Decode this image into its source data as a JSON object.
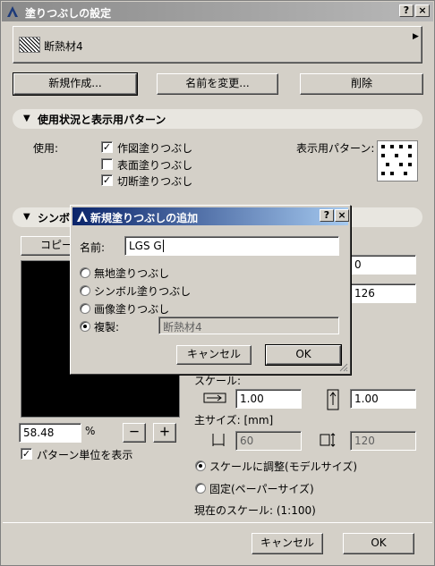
{
  "window": {
    "title": "塗りつぶしの設定",
    "help_btn": "?",
    "close_btn": "×",
    "fill_name": "断熱材4",
    "new_btn": "新規作成...",
    "rename_btn": "名前を変更...",
    "delete_btn": "削除",
    "usage_section": "使用状況と表示用パターン",
    "usage_label": "使用:",
    "usage_options": [
      {
        "label": "作図塗りつぶし",
        "checked": true
      },
      {
        "label": "表面塗りつぶし",
        "checked": false
      },
      {
        "label": "切断塗りつぶし",
        "checked": true
      }
    ],
    "display_pattern_label": "表示用パターン:",
    "symbol_section_partial": "シンボ",
    "copy_btn_partial": "コピー",
    "field_right_1_partial": "0",
    "field_right_2_partial": "126",
    "zoom_value": "58.48",
    "zoom_unit": "%",
    "zoom_out": "－",
    "zoom_in": "＋",
    "show_pattern_units": {
      "label": "パターン単位を表示",
      "checked": true
    },
    "scale_label": "スケール:",
    "scale_x": "1.00",
    "scale_y": "1.00",
    "main_size_label": "主サイズ: [mm]",
    "main_size_x": "60",
    "main_size_y": "120",
    "scale_mode_options": [
      {
        "label": "スケールに調整(モデルサイズ)",
        "selected": true
      },
      {
        "label": "固定(ペーパーサイズ)",
        "selected": false
      }
    ],
    "current_scale": "現在のスケール: (1:100)",
    "cancel_btn": "キャンセル",
    "ok_btn": "OK"
  },
  "dialog": {
    "title": "新規塗りつぶしの追加",
    "help_btn": "?",
    "close_btn": "×",
    "name_label": "名前:",
    "name_value": "LGS G",
    "options": [
      {
        "label": "無地塗りつぶし",
        "selected": false
      },
      {
        "label": "シンボル塗りつぶし",
        "selected": false
      },
      {
        "label": "画像塗りつぶし",
        "selected": false
      },
      {
        "label": "複製:",
        "selected": true
      }
    ],
    "duplicate_source": "断熱材4",
    "cancel_btn": "キャンセル",
    "ok_btn": "OK"
  }
}
